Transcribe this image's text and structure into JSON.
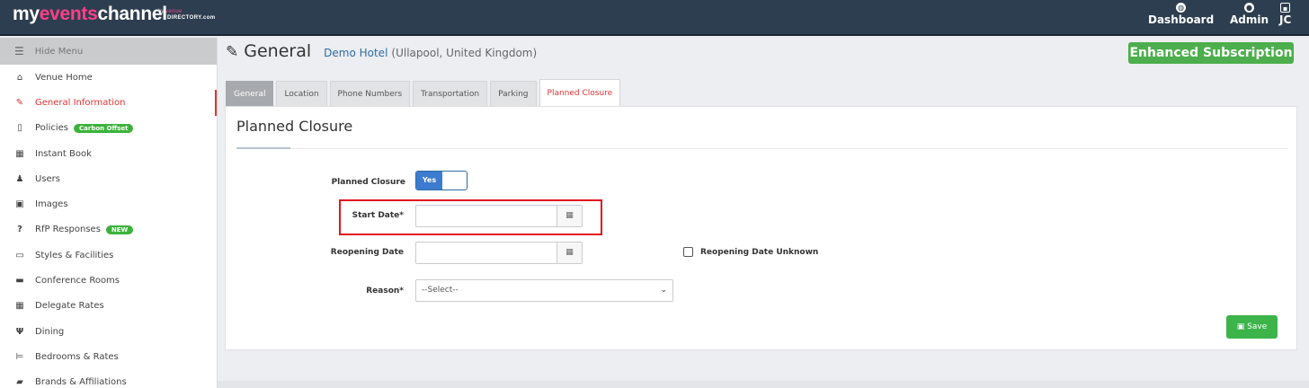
{
  "topbar": {
    "logo_pre": "my",
    "logo_mid": "events",
    "logo_post": "channel",
    "logo_by": "by",
    "logo_venue": "venue",
    "logo_directory": "DIRECTORY.com",
    "nav": [
      {
        "label": "Dashboard",
        "icon": "dashboard-icon"
      },
      {
        "label": "Admin",
        "icon": "user-circle-icon"
      },
      {
        "label": "JC",
        "icon": "user-square-icon"
      }
    ]
  },
  "sidebar": {
    "hide_menu": "Hide Menu",
    "items": [
      {
        "label": "Venue Home",
        "icon": "home-icon"
      },
      {
        "label": "General Information",
        "icon": "edit-icon",
        "active": true
      },
      {
        "label": "Policies",
        "icon": "document-icon",
        "badge": "Carbon Offset"
      },
      {
        "label": "Instant Book",
        "icon": "calendar-icon"
      },
      {
        "label": "Users",
        "icon": "user-icon"
      },
      {
        "label": "Images",
        "icon": "image-icon"
      },
      {
        "label": "RfP Responses",
        "icon": "question-icon",
        "badge": "NEW"
      },
      {
        "label": "Styles & Facilities",
        "icon": "monitor-icon"
      },
      {
        "label": "Conference Rooms",
        "icon": "briefcase-icon"
      },
      {
        "label": "Delegate Rates",
        "icon": "calculator-icon"
      },
      {
        "label": "Dining",
        "icon": "cutlery-icon"
      },
      {
        "label": "Bedrooms & Rates",
        "icon": "bed-icon"
      },
      {
        "label": "Brands & Affiliations",
        "icon": "tag-icon"
      }
    ]
  },
  "header": {
    "title": "General",
    "hotel": "Demo Hotel",
    "location": "(Ullapool, United Kingdom)",
    "subscription": "Enhanced Subscription"
  },
  "tabs": [
    "General",
    "Location",
    "Phone Numbers",
    "Transportation",
    "Parking",
    "Planned Closure"
  ],
  "form": {
    "heading": "Planned Closure",
    "planned_closure_label": "Planned Closure",
    "toggle_value": "Yes",
    "start_date_label": "Start Date*",
    "start_date_value": "",
    "reopening_date_label": "Reopening Date",
    "reopening_date_value": "",
    "reopening_unknown_label": "Reopening Date Unknown",
    "reason_label": "Reason*",
    "reason_value": "--Select--",
    "save_label": "Save"
  },
  "colors": {
    "topbar": "#2d3e50",
    "accent_red": "#d33333",
    "highlight": "#e4141e",
    "success": "#3cb44a",
    "link": "#2e6da4"
  }
}
